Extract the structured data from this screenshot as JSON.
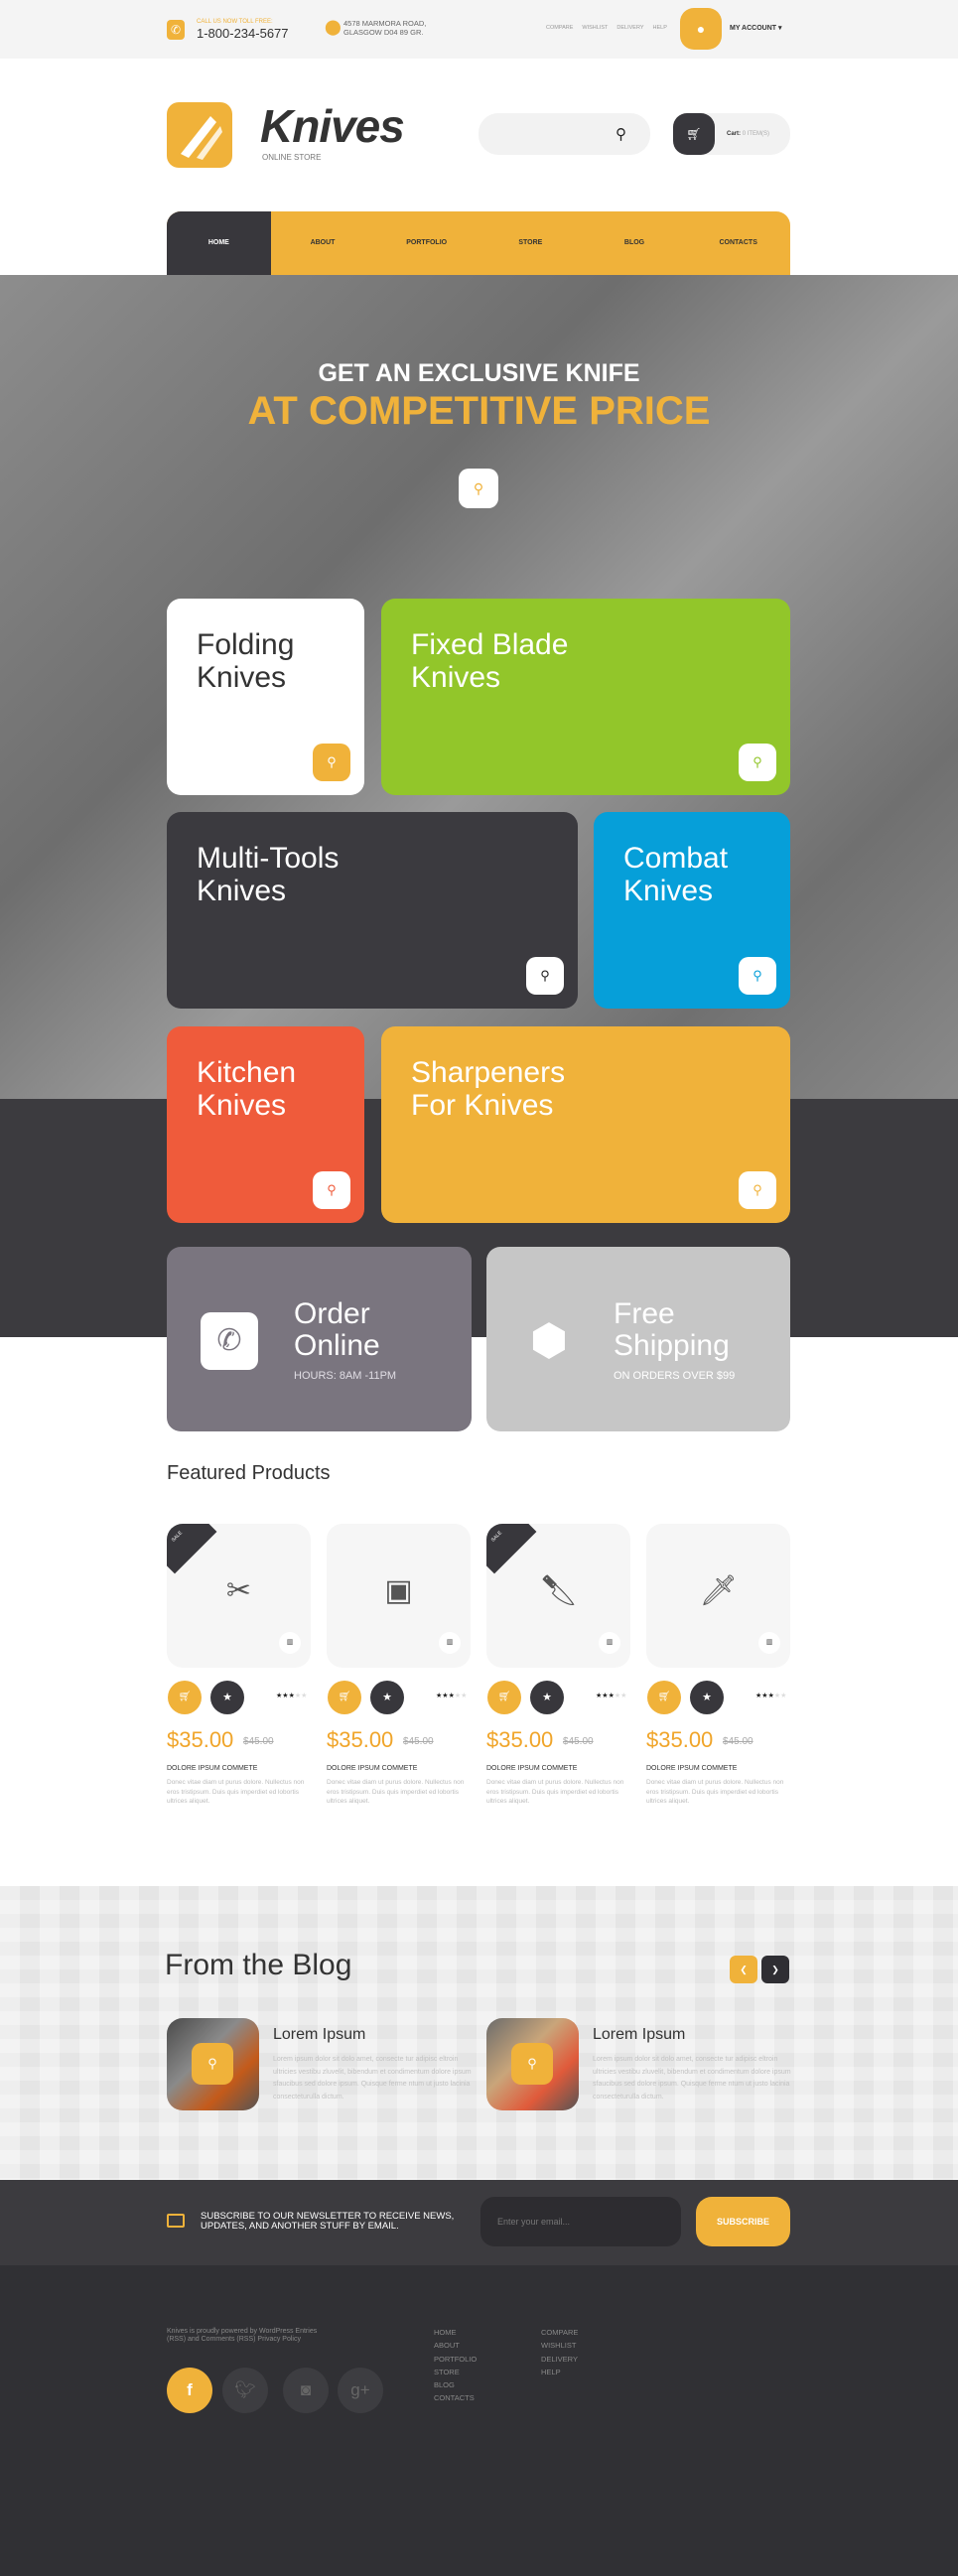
{
  "topbar": {
    "call_label": "CALL US NOW TOLL FREE:",
    "phone": "1-800-234-5677",
    "address_line1": "4578 MARMORA ROAD,",
    "address_line2": "GLASGOW D04 89 GR.",
    "links": [
      "COMPARE",
      "WISHLIST",
      "DELIVERY",
      "HELP"
    ],
    "account_label": "MY ACCOUNT ▾"
  },
  "header": {
    "logo_title": "Knives",
    "logo_subtitle": "ONLINE STORE",
    "search_placeholder": "",
    "cart_label": "Cart:",
    "cart_count": "0 ITEM(S)"
  },
  "nav": {
    "items": [
      "HOME",
      "ABOUT",
      "PORTFOLIO",
      "STORE",
      "BLOG",
      "CONTACTS"
    ],
    "active": "HOME"
  },
  "hero": {
    "line1": "GET AN EXCLUSIVE KNIFE",
    "line2": "AT COMPETITIVE PRICE"
  },
  "categories": [
    {
      "line1": "Folding",
      "line2": "Knives",
      "color": "#ffffff"
    },
    {
      "line1": "Fixed Blade",
      "line2": "Knives",
      "color": "#92c62a"
    },
    {
      "line1": "Multi-Tools",
      "line2": "Knives",
      "color": "#3b3a3f"
    },
    {
      "line1": "Combat",
      "line2": "Knives",
      "color": "#069fd9"
    },
    {
      "line1": "Kitchen",
      "line2": "Knives",
      "color": "#ef5b3b"
    },
    {
      "line1": "Sharpeners",
      "line2": "For Knives",
      "color": "#f0b23a"
    }
  ],
  "info": {
    "order": {
      "line1": "Order",
      "line2": "Online",
      "sub": "HOURS: 8AM -11PM"
    },
    "shipping": {
      "line1": "Free",
      "line2": "Shipping",
      "sub": "ON ORDERS OVER $99"
    }
  },
  "featured": {
    "title": "Featured Products",
    "products": [
      {
        "sale": "SALE",
        "price": "$35.00",
        "old_price": "$45.00",
        "name": "DOLORE IPSUM COMMETE",
        "desc": "Donec vitae diam ut purus dolore. Nullectus non eros tristipsum. Duis quis imperdiet ed lobortis ultrices aliquet.",
        "rating": 3,
        "max_rating": 5
      },
      {
        "sale": "",
        "price": "$35.00",
        "old_price": "$45.00",
        "name": "DOLORE IPSUM COMMETE",
        "desc": "Donec vitae diam ut purus dolore. Nullectus non eros tristipsum. Duis quis imperdiet ed lobortis ultrices aliquet.",
        "rating": 3,
        "max_rating": 5
      },
      {
        "sale": "SALE",
        "price": "$35.00",
        "old_price": "$45.00",
        "name": "DOLORE IPSUM COMMETE",
        "desc": "Donec vitae diam ut purus dolore. Nullectus non eros tristipsum. Duis quis imperdiet ed lobortis ultrices aliquet.",
        "rating": 3,
        "max_rating": 5
      },
      {
        "sale": "",
        "price": "$35.00",
        "old_price": "$45.00",
        "name": "DOLORE IPSUM COMMETE",
        "desc": "Donec vitae diam ut purus dolore. Nullectus non eros tristipsum. Duis quis imperdiet ed lobortis ultrices aliquet.",
        "rating": 3,
        "max_rating": 5
      }
    ]
  },
  "blog": {
    "title": "From the Blog",
    "posts": [
      {
        "title": "Lorem Ipsum",
        "text": "Lorem ipsum dolor sit dolo amet, consecte tur adipisc eltroin ultricies vestibu zluvelit, bibendum et condimentum dolore ipsum sfaucibus sed dolore ipsum. Quisque ferme ntum ut justo lacinia consecteturulla dictum."
      },
      {
        "title": "Lorem Ipsum",
        "text": "Lorem ipsum dolor sit dolo amet, consecte tur adipisc eltroin ultricies vestibu zluvelit, bibendum et condimentum dolore ipsum sfaucibus sed dolore ipsum. Quisque ferme ntum ut justo lacinia consecteturulla dictum."
      }
    ]
  },
  "newsletter": {
    "text_line1": "SUBSCRIBE TO OUR NEWSLETTER TO RECEIVE NEWS,",
    "text_line2": "UPDATES, AND ANOTHER STUFF BY EMAIL.",
    "email_placeholder": "Enter your email...",
    "button": "SUBSCRIBE"
  },
  "footer": {
    "credit_line1": "Knives is proudly powered by WordPress Entries",
    "credit_line2": "(RSS) and Comments (RSS) Privacy Policy",
    "col1": [
      "HOME",
      "ABOUT",
      "PORTFOLIO",
      "STORE",
      "BLOG",
      "CONTACTS"
    ],
    "col2": [
      "COMPARE",
      "WISHLIST",
      "DELIVERY",
      "HELP"
    ],
    "social": [
      "facebook",
      "twitter",
      "instagram",
      "google-plus"
    ]
  },
  "colors": {
    "accent": "#f0b23a",
    "dark": "#38373c"
  }
}
